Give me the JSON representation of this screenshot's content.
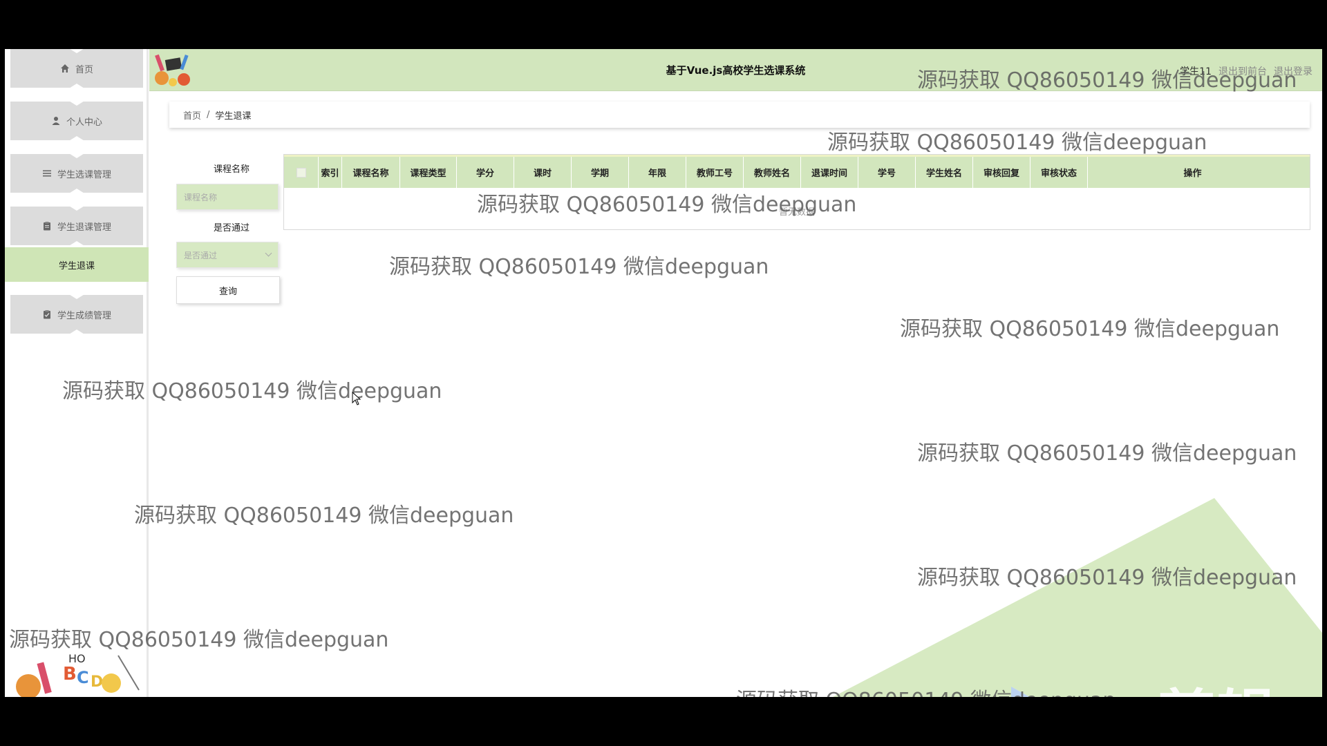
{
  "colors": {
    "accent": "#d2e6bd",
    "menu_bg": "#dcdcdc",
    "active_submenu": "#cfe5b6",
    "frame": "#000000"
  },
  "header": {
    "title": "基于Vue.js高校学生选课系统",
    "user": "学生11",
    "to_frontend": "退出到前台",
    "logout": "退出登录"
  },
  "sidebar": {
    "items": [
      {
        "label": "首页",
        "icon": "home-icon"
      },
      {
        "label": "个人中心",
        "icon": "user-icon"
      },
      {
        "label": "学生选课管理",
        "icon": "list-icon"
      },
      {
        "label": "学生退课管理",
        "icon": "clipboard-icon"
      },
      {
        "label": "学生成绩管理",
        "icon": "clipboard-check-icon"
      }
    ],
    "active_sub": "学生退课"
  },
  "breadcrumb": {
    "home": "首页",
    "separator": "/",
    "current": "学生退课"
  },
  "filters": {
    "course_name_label": "课程名称",
    "course_name_placeholder": "课程名称",
    "passed_label": "是否通过",
    "passed_placeholder": "是否通过",
    "query_button": "查询"
  },
  "table": {
    "columns": [
      "索引",
      "课程名称",
      "课程类型",
      "学分",
      "课时",
      "学期",
      "年限",
      "教师工号",
      "教师姓名",
      "退课时间",
      "学号",
      "学生姓名",
      "审核回复",
      "审核状态",
      "操作"
    ],
    "empty_text": "暂无数据"
  },
  "watermark": "源码获取 QQ86050149 微信deepguan",
  "editor_brand": "ev剪辑"
}
